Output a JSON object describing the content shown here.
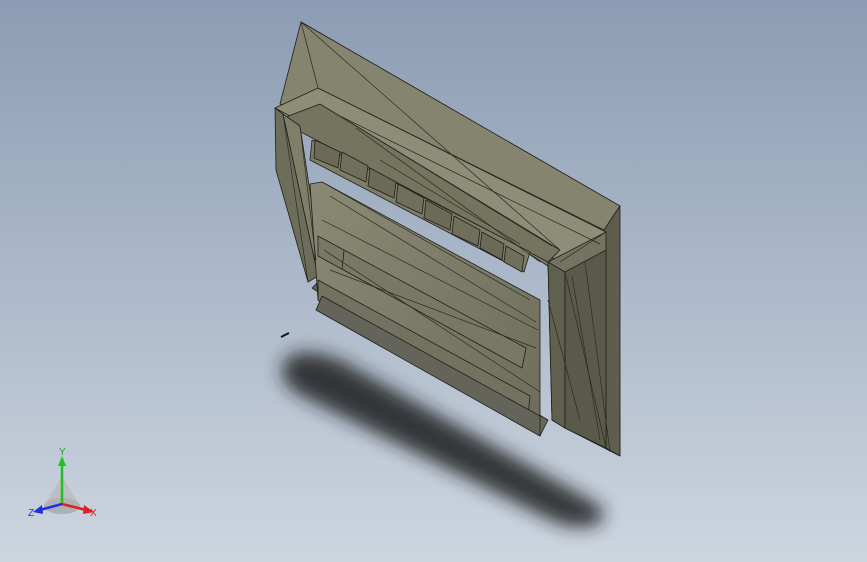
{
  "viewport": {
    "background_top": "#8c9cb3",
    "background_bottom": "#cdd5df"
  },
  "model": {
    "face_color": "#7a7a66",
    "edge_color": "#1f1f1a"
  },
  "triad": {
    "x_label": "X",
    "y_label": "Y",
    "z_label": "Z",
    "x_color": "#e02020",
    "y_color": "#20c020",
    "z_color": "#2030e0"
  }
}
